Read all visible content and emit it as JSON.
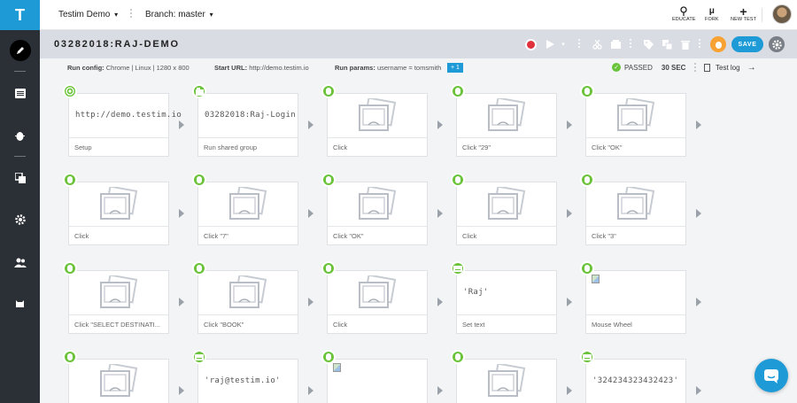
{
  "app": {
    "logo_letter": "T"
  },
  "topbar": {
    "project": "Testim Demo",
    "branch_label": "Branch: master",
    "actions": [
      {
        "label": "EDUCATE",
        "icon": "pin-icon"
      },
      {
        "label": "FORK",
        "icon": "fork-icon"
      },
      {
        "label": "NEW TEST",
        "icon": "plus-icon"
      }
    ]
  },
  "test": {
    "name": "03282018:RAJ-DEMO",
    "save_label": "SAVE"
  },
  "info": {
    "run_config_label": "Run config:",
    "run_config_value": "Chrome | Linux | 1280 x 800",
    "start_url_label": "Start URL:",
    "start_url_value": "http://demo.testim.io",
    "run_params_label": "Run params:",
    "run_params_value": "username = tomsmith",
    "run_params_extra": "+ 1",
    "status": "PASSED",
    "duration": "30 SEC",
    "test_log": "Test log"
  },
  "steps": [
    {
      "desc": "Setup",
      "badge": "chrome",
      "content": "url",
      "text": "http://demo.testim.io"
    },
    {
      "desc": "Run shared group",
      "badge": "group",
      "content": "url",
      "text": "03282018:Raj-Login"
    },
    {
      "desc": "Click",
      "badge": "mouse",
      "content": "thumb"
    },
    {
      "desc": "Click \"29\"",
      "badge": "mouse",
      "content": "thumb"
    },
    {
      "desc": "Click \"OK\"",
      "badge": "mouse",
      "content": "thumb"
    },
    {
      "desc": "Click",
      "badge": "mouse",
      "content": "thumb"
    },
    {
      "desc": "Click \"7\"",
      "badge": "mouse",
      "content": "thumb"
    },
    {
      "desc": "Click \"OK\"",
      "badge": "mouse",
      "content": "thumb"
    },
    {
      "desc": "Click",
      "badge": "mouse",
      "content": "thumb"
    },
    {
      "desc": "Click \"3\"",
      "badge": "mouse",
      "content": "thumb"
    },
    {
      "desc": "Click \"SELECT DESTINATI...",
      "badge": "mouse",
      "content": "thumb"
    },
    {
      "desc": "Click \"BOOK\"",
      "badge": "mouse",
      "content": "thumb"
    },
    {
      "desc": "Click",
      "badge": "mouse",
      "content": "thumb"
    },
    {
      "desc": "Set text",
      "badge": "keyboard",
      "content": "url",
      "text": "'Raj'"
    },
    {
      "desc": "Mouse Wheel",
      "badge": "mouse",
      "content": "broken"
    },
    {
      "desc": "",
      "badge": "mouse",
      "content": "thumb"
    },
    {
      "desc": "",
      "badge": "keyboard",
      "content": "url",
      "text": "'raj@testim.io'"
    },
    {
      "desc": "",
      "badge": "mouse",
      "content": "broken"
    },
    {
      "desc": "",
      "badge": "mouse",
      "content": "thumb"
    },
    {
      "desc": "",
      "badge": "keyboard",
      "content": "url",
      "text": "'324234323432423'"
    }
  ],
  "colors": {
    "accent": "#1e9bd7",
    "success": "#6bc33b",
    "record": "#e0323c",
    "bug": "#f7a233",
    "sidebar": "#2b2f36"
  }
}
